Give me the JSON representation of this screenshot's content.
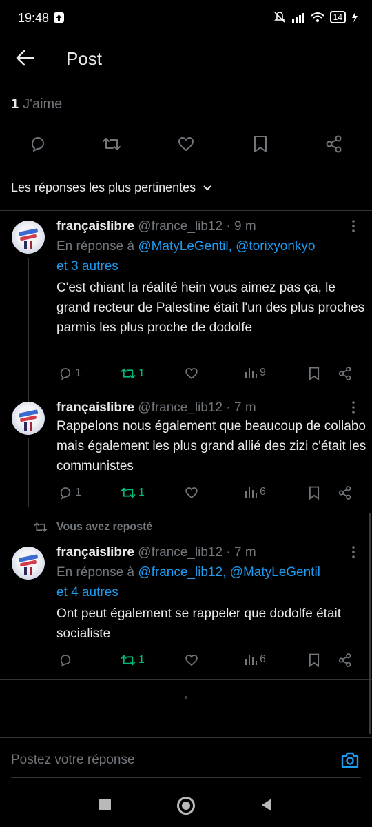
{
  "status_bar": {
    "time": "19:48",
    "battery": "14"
  },
  "header": {
    "back_icon": "arrow-left-icon",
    "title": "Post"
  },
  "likes": {
    "count": "1",
    "label": "J'aime"
  },
  "post_actions": [
    "reply-icon",
    "repost-icon",
    "like-icon",
    "bookmark-icon",
    "share-icon"
  ],
  "sort": {
    "label": "Les réponses les plus pertinentes"
  },
  "tweets": [
    {
      "name": "françaislibre",
      "handle": "@france_lib12",
      "time": "· 9 m",
      "reply_prefix": "En réponse à",
      "mentions": "@MatyLeGentil, @torixyonkyo",
      "others": "et 3 autres",
      "text": "C'est chiant la réalité hein vous aimez pas ça, le grand recteur de Palestine était l'un des plus proches parmis les plus proche de dodolfe",
      "replies": "1",
      "reposts": "1",
      "likes": "",
      "views": "9"
    },
    {
      "name": "françaislibre",
      "handle": "@france_lib12",
      "time": "· 7 m",
      "text": "Rappelons nous également que beaucoup de collabo mais également les plus grand allié des zizi c'était les communistes",
      "replies": "1",
      "reposts": "1",
      "likes": "",
      "views": "6"
    },
    {
      "repost_note": "Vous avez reposté",
      "name": "françaislibre",
      "handle": "@france_lib12",
      "time": "· 7 m",
      "reply_prefix": "En réponse à",
      "mentions": "@france_lib12, @MatyLeGentil",
      "others": "et 4 autres",
      "text": "Ont peut également se rappeler que dodolfe était socialiste",
      "replies": "",
      "reposts": "1",
      "likes": "",
      "views": "6"
    }
  ],
  "reply_bar": {
    "placeholder": "Postez votre réponse",
    "camera_icon": "camera-icon"
  },
  "colors": {
    "accent": "#1d9bf0",
    "repost_green": "#00ba7c",
    "muted": "#71767b",
    "background": "#000000"
  }
}
